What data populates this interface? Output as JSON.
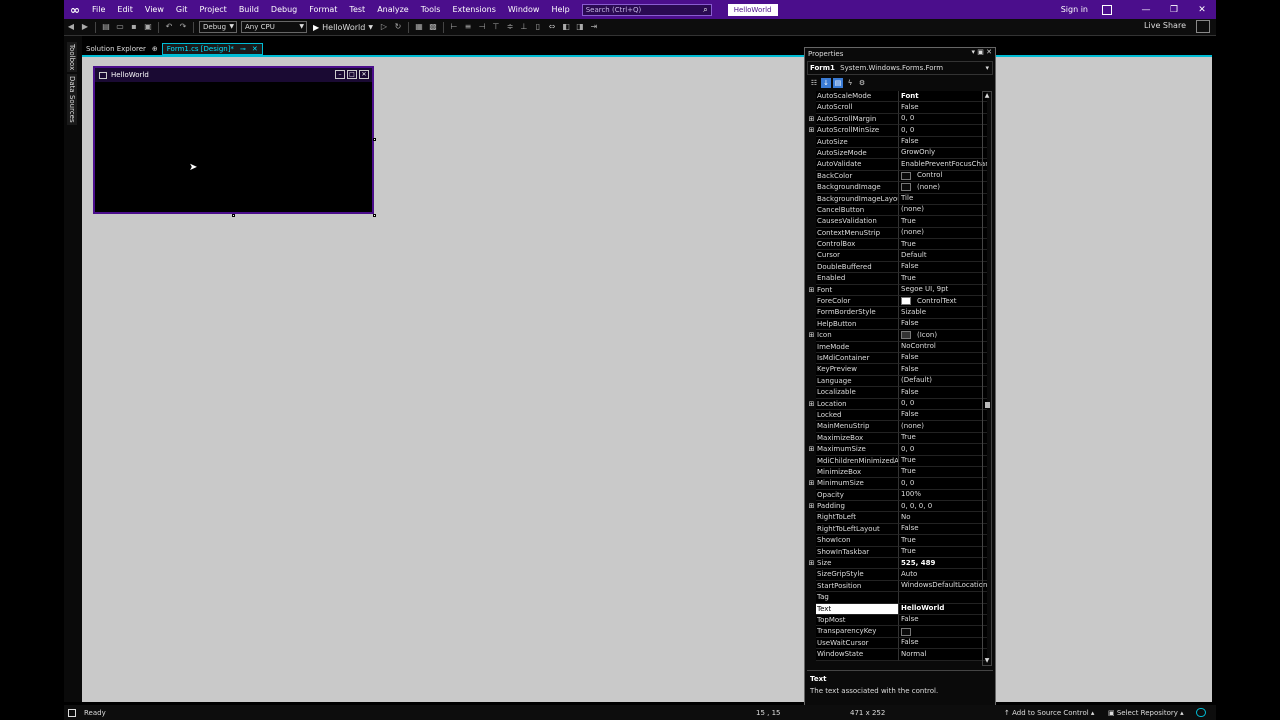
{
  "title_bar": {
    "menu": [
      "File",
      "Edit",
      "View",
      "Git",
      "Project",
      "Build",
      "Debug",
      "Format",
      "Test",
      "Analyze",
      "Tools",
      "Extensions",
      "Window",
      "Help"
    ],
    "search_placeholder": "Search (Ctrl+Q)",
    "solution_name": "HelloWorld",
    "sign_in": "Sign in",
    "accent": "#4b0e8c"
  },
  "toolbar": {
    "config": "Debug",
    "platform": "Any CPU",
    "run_label": "HelloWorld",
    "live_share": "Live Share"
  },
  "side_tabs": [
    "Toolbox",
    "Data Sources"
  ],
  "doc_tabs": [
    {
      "label": "Solution Explorer",
      "active": false
    },
    {
      "label": "Form1.cs [Design]*",
      "active": true
    }
  ],
  "form": {
    "title": "HelloWorld"
  },
  "properties": {
    "panel_title": "Properties",
    "object_name": "Form1",
    "object_type": "System.Windows.Forms.Form",
    "rows": [
      {
        "exp": "",
        "name": "AutoScaleMode",
        "value": "Font",
        "bold": true
      },
      {
        "exp": "",
        "name": "AutoScroll",
        "value": "False"
      },
      {
        "exp": "⊞",
        "name": "AutoScrollMargin",
        "value": "0, 0"
      },
      {
        "exp": "⊞",
        "name": "AutoScrollMinSize",
        "value": "0, 0"
      },
      {
        "exp": "",
        "name": "AutoSize",
        "value": "False"
      },
      {
        "exp": "",
        "name": "AutoSizeMode",
        "value": "GrowOnly"
      },
      {
        "exp": "",
        "name": "AutoValidate",
        "value": "EnablePreventFocusChang"
      },
      {
        "exp": "",
        "name": "BackColor",
        "value": "Control",
        "swatch": "#0a0a0a"
      },
      {
        "exp": "",
        "name": "BackgroundImage",
        "value": "(none)",
        "swatch": "#0a0a0a"
      },
      {
        "exp": "",
        "name": "BackgroundImageLayout",
        "value": "Tile"
      },
      {
        "exp": "",
        "name": "CancelButton",
        "value": "(none)"
      },
      {
        "exp": "",
        "name": "CausesValidation",
        "value": "True"
      },
      {
        "exp": "",
        "name": "ContextMenuStrip",
        "value": "(none)"
      },
      {
        "exp": "",
        "name": "ControlBox",
        "value": "True"
      },
      {
        "exp": "",
        "name": "Cursor",
        "value": "Default"
      },
      {
        "exp": "",
        "name": "DoubleBuffered",
        "value": "False"
      },
      {
        "exp": "",
        "name": "Enabled",
        "value": "True"
      },
      {
        "exp": "⊞",
        "name": "Font",
        "value": "Segoe UI, 9pt"
      },
      {
        "exp": "",
        "name": "ForeColor",
        "value": "ControlText",
        "swatch": "#ffffff"
      },
      {
        "exp": "",
        "name": "FormBorderStyle",
        "value": "Sizable"
      },
      {
        "exp": "",
        "name": "HelpButton",
        "value": "False"
      },
      {
        "exp": "⊞",
        "name": "Icon",
        "value": "(Icon)",
        "swatch": "#333333"
      },
      {
        "exp": "",
        "name": "ImeMode",
        "value": "NoControl"
      },
      {
        "exp": "",
        "name": "IsMdiContainer",
        "value": "False"
      },
      {
        "exp": "",
        "name": "KeyPreview",
        "value": "False"
      },
      {
        "exp": "",
        "name": "Language",
        "value": "(Default)"
      },
      {
        "exp": "",
        "name": "Localizable",
        "value": "False"
      },
      {
        "exp": "⊞",
        "name": "Location",
        "value": "0, 0"
      },
      {
        "exp": "",
        "name": "Locked",
        "value": "False"
      },
      {
        "exp": "",
        "name": "MainMenuStrip",
        "value": "(none)"
      },
      {
        "exp": "",
        "name": "MaximizeBox",
        "value": "True"
      },
      {
        "exp": "⊞",
        "name": "MaximumSize",
        "value": "0, 0"
      },
      {
        "exp": "",
        "name": "MdiChildrenMinimizedAn",
        "value": "True"
      },
      {
        "exp": "",
        "name": "MinimizeBox",
        "value": "True"
      },
      {
        "exp": "⊞",
        "name": "MinimumSize",
        "value": "0, 0"
      },
      {
        "exp": "",
        "name": "Opacity",
        "value": "100%"
      },
      {
        "exp": "⊞",
        "name": "Padding",
        "value": "0, 0, 0, 0"
      },
      {
        "exp": "",
        "name": "RightToLeft",
        "value": "No"
      },
      {
        "exp": "",
        "name": "RightToLeftLayout",
        "value": "False"
      },
      {
        "exp": "",
        "name": "ShowIcon",
        "value": "True"
      },
      {
        "exp": "",
        "name": "ShowInTaskbar",
        "value": "True"
      },
      {
        "exp": "⊞",
        "name": "Size",
        "value": "525, 489",
        "bold": true
      },
      {
        "exp": "",
        "name": "SizeGripStyle",
        "value": "Auto"
      },
      {
        "exp": "",
        "name": "StartPosition",
        "value": "WindowsDefaultLocation"
      },
      {
        "exp": "",
        "name": "Tag",
        "value": ""
      },
      {
        "exp": "",
        "name": "Text",
        "value": "HelloWorld",
        "bold": true,
        "selected": true
      },
      {
        "exp": "",
        "name": "TopMost",
        "value": "False"
      },
      {
        "exp": "",
        "name": "TransparencyKey",
        "value": "",
        "swatch": "#0a0a0a"
      },
      {
        "exp": "",
        "name": "UseWaitCursor",
        "value": "False"
      },
      {
        "exp": "",
        "name": "WindowState",
        "value": "Normal"
      }
    ],
    "description_title": "Text",
    "description_text": "The text associated with the control."
  },
  "status_bar": {
    "ready": "Ready",
    "position": "15 , 15",
    "size": "471 x 252",
    "add_source": "Add to Source Control",
    "select_repo": "Select Repository"
  }
}
